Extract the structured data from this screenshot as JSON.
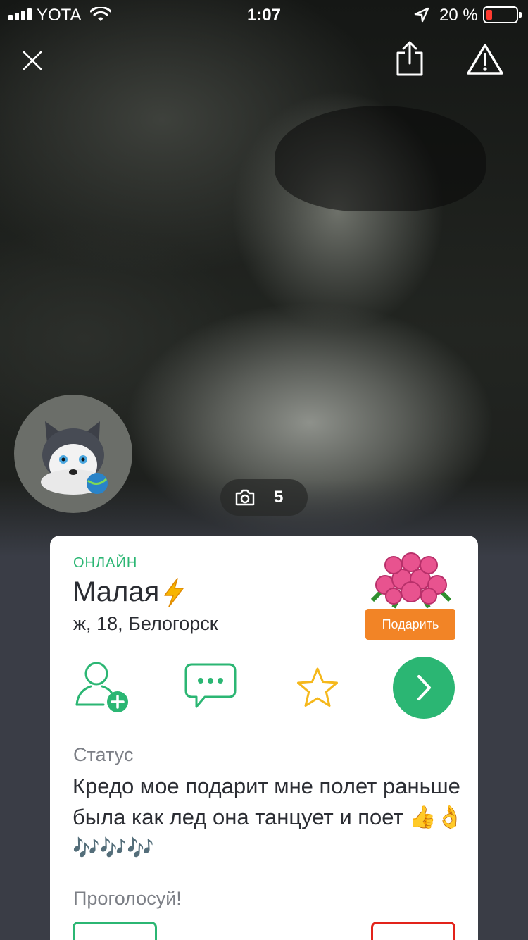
{
  "status_bar": {
    "carrier": "YOTA",
    "time": "1:07",
    "battery": "20 %"
  },
  "top_bar": {
    "icons": [
      "close-icon",
      "share-icon",
      "warning-icon"
    ]
  },
  "photo": {
    "count": "5",
    "counter_icon": "camera-icon"
  },
  "profile": {
    "online": "ОНЛАЙН",
    "name": "Малая",
    "name_badge_icon": "lightning-icon",
    "details": "ж, 18, Белогорск",
    "gift_label": "Подарить"
  },
  "actions": [
    "add-friend-icon",
    "message-icon",
    "star-icon",
    "chevron-right-icon"
  ],
  "status": {
    "label": "Статус",
    "text": "Кредо мое подарит мне полет раньше была как лед она танцует и поет 👍👌🎶🎶🎶"
  },
  "vote": {
    "label": "Проголосуй!"
  },
  "colors": {
    "accent_green": "#2bb673",
    "gift_orange": "#f28426",
    "vote_red": "#e2231a",
    "backdrop": "#3a3d46"
  }
}
